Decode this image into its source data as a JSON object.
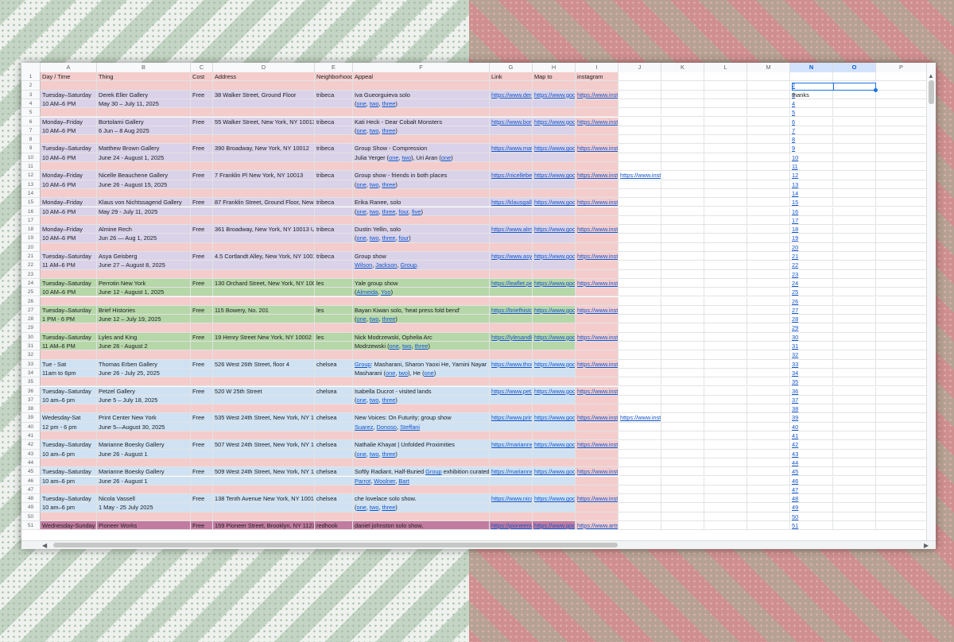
{
  "columns": [
    "A",
    "B",
    "C",
    "D",
    "E",
    "F",
    "G",
    "H",
    "I",
    "J",
    "K",
    "L",
    "M",
    "N",
    "O",
    "P"
  ],
  "header": {
    "day": "Day / Time",
    "thing": "Thing",
    "cost": "Cost",
    "address": "Address",
    "neighborhood": "Neighborhood",
    "appeal": "Appeal",
    "link": "Link",
    "map": "Map to",
    "instagram": "instagram"
  },
  "note_text": "thanks",
  "colors": {
    "purple": "#d9d2e9",
    "pink": "#f4cccc",
    "green": "#b6d7a8",
    "blue": "#cfe2f3",
    "magenta": "#c27ba0",
    "link": "#1155cc",
    "selection": "#1a73e8"
  },
  "rows": [
    {
      "n": "2",
      "type": "pink"
    },
    {
      "n": "3",
      "type": "purple",
      "a": "Tuesday–Saturday",
      "b": "Derek Eller Gallery",
      "c": "Free",
      "d": "38 Walker Street, Ground Floor",
      "e": "tribeca",
      "f": "Iva Gueorguieva solo",
      "g": "https://www.dere",
      "h": "https://www.goog",
      "i": "https://www.instagram.com/ivagueorguieva/?hl=en"
    },
    {
      "n": "4",
      "type": "purple",
      "a": "10 AM–6 PM",
      "b": "May 30 – July 11, 2025",
      "f": "(one, two, three)"
    },
    {
      "n": "5",
      "type": "pink"
    },
    {
      "n": "6",
      "type": "purple",
      "a": "Monday–Friday",
      "b": "Bortolami Gallery",
      "c": "Free",
      "d": "55 Walker Street, New York, NY 10013",
      "e": "tribeca",
      "f": "Kati Heck - Dear Cobalt Monsters",
      "g": "https://www.borto",
      "h": "https://www.goog",
      "i": "https://www.instagram.com/bortolamigallery/"
    },
    {
      "n": "7",
      "type": "purple",
      "a": "10 AM–6 PM",
      "b": "6 Jun – 8 Aug 2025",
      "f": "(one, two, three)"
    },
    {
      "n": "8",
      "type": "pink"
    },
    {
      "n": "9",
      "type": "purple",
      "a": "Tuesday–Saturday",
      "b": "Matthew Brown Gallery",
      "c": "Free",
      "d": "390 Broadway, New York, NY 10012",
      "e": "tribeca",
      "f": "Group Show - Compression",
      "g": "https://www.matt",
      "h": "https://www.goog",
      "i": "https://www.instagram.com/littledogslikethese/?hl=en"
    },
    {
      "n": "10",
      "type": "purple",
      "a": "10 AM–6 PM",
      "b": "June 24 - August 1, 2025",
      "f": "Julia Yerger (one, two), Uri Aran (one)"
    },
    {
      "n": "11",
      "type": "pink"
    },
    {
      "n": "12",
      "type": "purple",
      "a": "Monday–Friday",
      "b": "Nicelle Beauchene Gallery",
      "c": "Free",
      "d": "7 Franklin Pl New York, NY 10013",
      "e": "tribeca",
      "f": "Group show - friends in both places",
      "g": "https://nicellebea",
      "h": "https://www.goog",
      "i": "https://www.insta",
      "j": "https://www.instagram.com/julia_yerger/?hl=en"
    },
    {
      "n": "13",
      "type": "purple",
      "a": "10 AM–6 PM",
      "b": "June 26 - August 15, 2025",
      "f": "(one, two, three)"
    },
    {
      "n": "14",
      "type": "pink"
    },
    {
      "n": "15",
      "type": "purple",
      "a": "Monday–Friday",
      "b": "Klaus von Nichtssagend Gallery",
      "c": "Free",
      "d": "87 Franklin Street, Ground Floor, New Y",
      "e": "tribeca",
      "f": "Erika Ranee, solo",
      "g": "https://klausgalle",
      "h": "https://www.goog",
      "i": "https://www.instagram.com/erikaranee/?hl=en"
    },
    {
      "n": "16",
      "type": "purple",
      "a": "10 AM–6 PM",
      "b": " May 29 - July 11, 2025",
      "f": "(one, two, three, four, five)"
    },
    {
      "n": "17",
      "type": "pink"
    },
    {
      "n": "18",
      "type": "purple",
      "a": "Monday–Friday",
      "b": "Almine Rech",
      "c": "Free",
      "d": "361 Broadway, New York, NY 10013 US",
      "e": "tribeca",
      "f": "Dustin Yellin, solo",
      "g": "https://www.almi",
      "h": "https://www.goog",
      "i": "https://www.instagram.com/dustinyellin/?hl=en"
    },
    {
      "n": "19",
      "type": "purple",
      "a": "10 AM–6 PM",
      "b": "Jun 26 — Aug 1, 2025",
      "f": "(one, two, three, four)"
    },
    {
      "n": "20",
      "type": "pink"
    },
    {
      "n": "21",
      "type": "purple",
      "a": "Tuesday–Saturday",
      "b": "Asya Geisberg",
      "c": "Free",
      "d": "4.5 Cortlandt Alley, New York, NY 1001",
      "e": "tribeca",
      "f": "Group show",
      "g": "https://www.asya",
      "h": "https://www.goog",
      "i": "https://www.instagram.com/asyageisberggallery/?hl=en"
    },
    {
      "n": "22",
      "type": "purple",
      "a": "11 AM–6 PM",
      "b": "June 27 – August 8, 2025",
      "f": "Wilson, Jackson, Group."
    },
    {
      "n": "23",
      "type": "pink"
    },
    {
      "n": "24",
      "type": "green",
      "a": "Tuesday–Saturday",
      "b": "Perrotin New York",
      "c": "Free",
      "d": "130 Orchard Street, New York, NY 1000",
      "e": "les",
      "f": "Yale group show",
      "g": "https://leaflet.per",
      "h": "https://www.goog",
      "i": "https://www.instagram.com/jam.yovoyo/?hl=en"
    },
    {
      "n": "25",
      "type": "green",
      "a": "10 AM–6 PM",
      "b": " June 12 - August 1, 2025",
      "f": "(Almeida, Yoo)"
    },
    {
      "n": "26",
      "type": "pink"
    },
    {
      "n": "27",
      "type": "green",
      "a": "Tuesday–Saturday",
      "b": "Brief Histories",
      "c": "Free",
      "d": "115 Bowery, No. 201",
      "e": "les",
      "f": "Bayan Kiwan solo, 'heat press fold bend'",
      "g": "https://briefhistor",
      "h": "https://www.goog",
      "i": "https://www.instagram.com/bayankiw/?hl=en"
    },
    {
      "n": "28",
      "type": "green",
      "a": "1 PM - 6 PM",
      "b": "June 12 – July 19, 2025",
      "f": "(one, two, three)"
    },
    {
      "n": "29",
      "type": "pink"
    },
    {
      "n": "30",
      "type": "green",
      "a": "Tuesday–Saturday",
      "b": "Lyles and King",
      "c": "Free",
      "d": "19 Henry Street New York, NY 10002",
      "e": "les",
      "f": "Nick Modrzewski, Ophelia Arc",
      "g": "https://lylesandki",
      "h": "https://www.goog",
      "i": "https://www.instagram.com/nickmodrzewski/?hl=en"
    },
    {
      "n": "31",
      "type": "green",
      "a": "11 AM–6 PM",
      "b": "June 26 - August 2",
      "f": "Modrzewski (one, two, three)"
    },
    {
      "n": "32",
      "type": "pink"
    },
    {
      "n": "33",
      "type": "blue",
      "a": "Tue - Sat",
      "b": "Thomas Erben Gallery",
      "c": "Free",
      "d": "526 West 26th Street, floor 4",
      "e": "chelsea",
      "f": "Group: Masharani, Sharon Yaoxi He, Yamini Nayar",
      "g": "https://www.thon",
      "h": "https://www.goog",
      "i": "https://www.instagram.com/vijay.masharani/?hl=en"
    },
    {
      "n": "34",
      "type": "blue",
      "a": "  11am to 6pm",
      "b": "June 26 - July 25, 2025",
      "f": "Masharani (one, two), He (one)"
    },
    {
      "n": "35",
      "type": "pink"
    },
    {
      "n": "36",
      "type": "blue",
      "a": "Tuesday–Saturday",
      "b": "Petzel Gallery",
      "c": "Free",
      "d": "520 W 25th Street",
      "e": "chelsea",
      "f": "Isabella Ducrot - visited lands",
      "g": "https://www.petz",
      "h": "https://www.goog",
      "i": "https://www.instagram.com/ducrotisabella/?hl=en"
    },
    {
      "n": "37",
      "type": "blue",
      "a": "10 am–6 pm",
      "b": "June 5 – July 18, 2025",
      "f": "(one, two, three)"
    },
    {
      "n": "38",
      "type": "pink"
    },
    {
      "n": "39",
      "type": "blue",
      "a": "Wedesday-Sat",
      "b": "Print Center New York",
      "c": "Free",
      "d": "535 West 24th Street, New York, NY 10",
      "e": "chelsea",
      "f": "New Voices: On Futurity; group show",
      "g": "https://www.print",
      "h": "https://www.goog",
      "i": "https://www.insta",
      "j": "https://www.instagram.com/aimeeparrott/?hl=en"
    },
    {
      "n": "40",
      "type": "blue",
      "a": "12 pm - 6 pm",
      "b": "June 5—August 30, 2025",
      "f": "Suarez, Donoso, Steffani"
    },
    {
      "n": "41",
      "type": "pink"
    },
    {
      "n": "42",
      "type": "blue",
      "a": "Tuesday–Saturday",
      "b": "Marianne Boesky Gallery",
      "c": "Free",
      "d": "507 West 24th Street, New York, NY 10",
      "e": "chelsea",
      "f": "Nathalie Khayat | Unfolded Proximities",
      "g": "https://marianne",
      "h": "https://www.goog",
      "i": "https://www.instagram.com/nathaliekhayatceramics/?hl=en"
    },
    {
      "n": "43",
      "type": "blue",
      "a": "10 am–6 pm",
      "b": "June 26 - August 1",
      "f": "(one, two, three)"
    },
    {
      "n": "44",
      "type": "pink"
    },
    {
      "n": "45",
      "type": "blue",
      "a": "Tuesday–Saturday",
      "b": "Marianne Boesky Gallery",
      "c": "Free",
      "d": "509 West 24th Street, New York, NY 10",
      "e": "chelsea",
      "f": "Softly Radiant, Half-Buried Group exhibition curated b",
      "g": "https://marianne",
      "h": "https://www.goog",
      "i": "https://www.instagram.com/hannahvanbart3/"
    },
    {
      "n": "46",
      "type": "blue",
      "a": "10 am–6 pm",
      "b": "June 26 - August 1",
      "f": "Parrot, Woolner, Bart"
    },
    {
      "n": "47",
      "type": "pink"
    },
    {
      "n": "48",
      "type": "blue",
      "a": "Tuesday–Saturday",
      "b": "Nicola Vassell",
      "c": "Free",
      "d": "138 Tenth Avenue New York, NY 10011",
      "e": "chelsea",
      "f": "che lovelace solo show.",
      "g": "https://www.nico",
      "h": "https://www.goog",
      "i": "https://www.instagram.com/chelovelace/?hl=en"
    },
    {
      "n": "49",
      "type": "blue",
      "a": "10 am–6 pm",
      "b": "1 May - 25 July 2025",
      "f": "(one, two, three)"
    },
    {
      "n": "50",
      "type": "pink"
    },
    {
      "n": "51",
      "type": "magenta",
      "a": "Wednesday-Sunday",
      "b": "Pioneer Works",
      "c": "Free",
      "d": "159 Pioneer Street, Brooklyn, NY 11231",
      "e": "redhook",
      "f": "daniel johnston solo show,",
      "g": "https://pioneerw",
      "h": "https://www.goog",
      "i": "https://www.artsy.net/artist/daniel-johnston"
    }
  ]
}
